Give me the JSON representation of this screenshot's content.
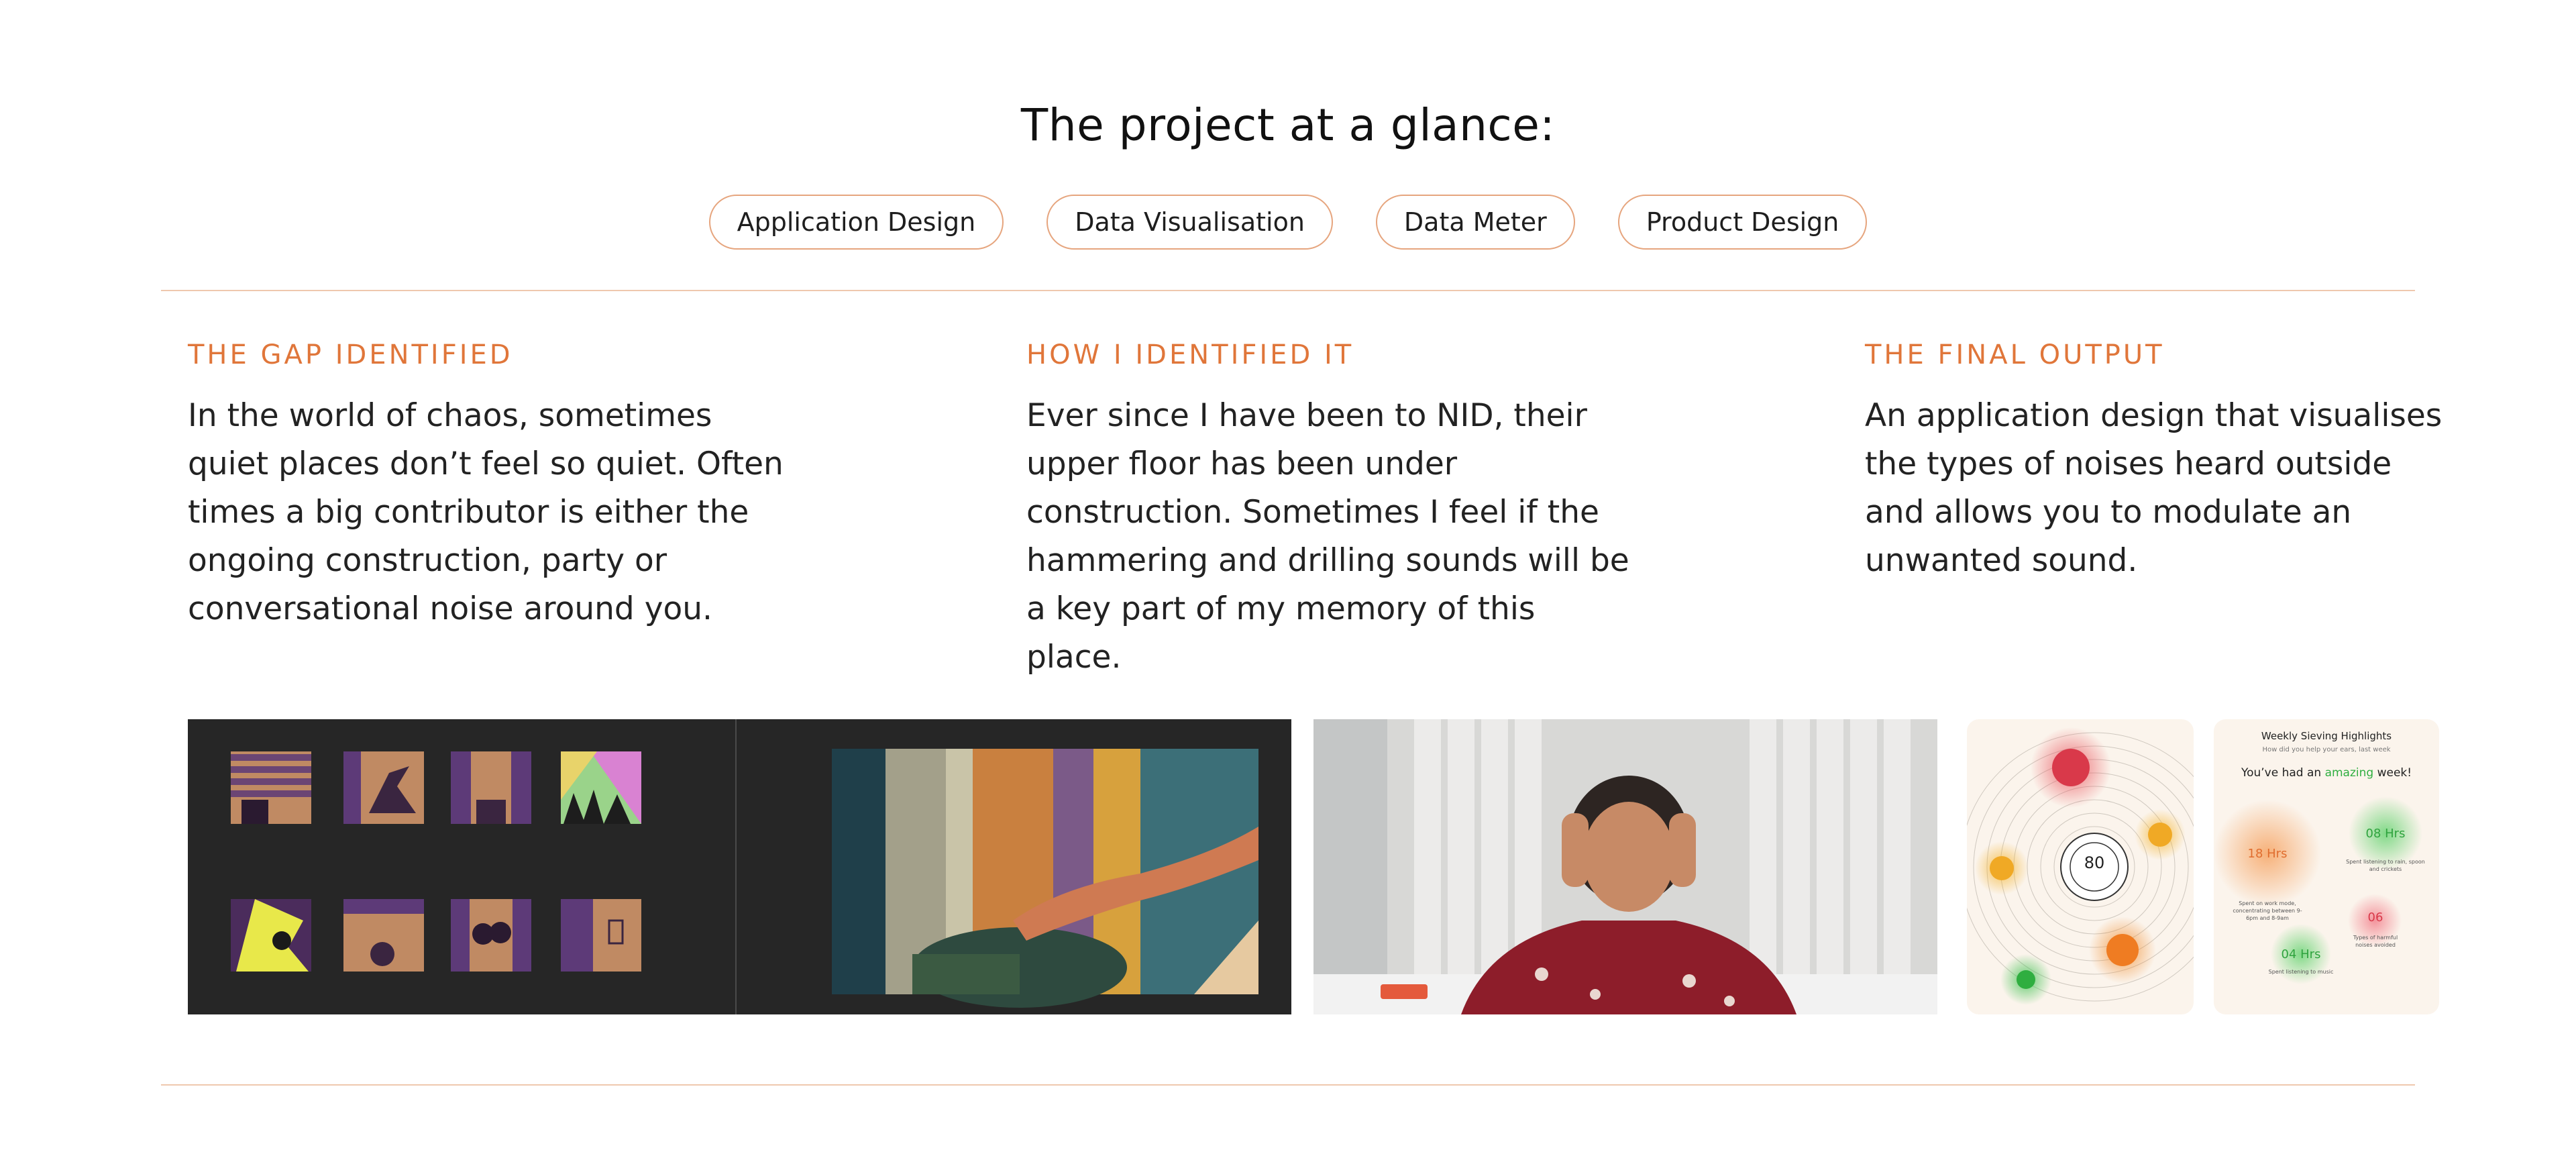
{
  "page": {
    "title": "The project at a glance:"
  },
  "tags": [
    "Application Design",
    "Data Visualisation",
    "Data Meter",
    "Product Design"
  ],
  "columns": [
    {
      "heading": "THE GAP IDENTIFIED",
      "lines": [
        "In the world of chaos, sometimes",
        "quiet places don’t feel so quiet. Often",
        "times a big contributor is either the",
        "ongoing construction, party or",
        "conversational noise around you."
      ]
    },
    {
      "heading": "HOW I IDENTIFIED IT",
      "lines": [
        "Ever since I have been to NID, their",
        "upper floor has been under",
        "construction. Sometimes I feel if the",
        "hammering and drilling sounds will be",
        "a key part of my memory of this place."
      ]
    },
    {
      "heading": "THE FINAL OUTPUT",
      "lines": [
        "An application design that visualises",
        "the types of noises heard outside",
        "and allows you to modulate an",
        "unwanted sound."
      ]
    }
  ],
  "app_screen_radial": {
    "center_value": "80"
  },
  "app_screen_summary": {
    "title": "Weekly Sieving Highlights",
    "subtitle": "How did you help your ears, last week",
    "headline_prefix": "You’ve had an ",
    "headline_accent": "amazing",
    "headline_suffix": " week!",
    "stats": [
      {
        "value": "18 Hrs",
        "label": "Spent on work mode, concentrating between 9-6pm and 8-9am"
      },
      {
        "value": "08 Hrs",
        "label": "Spent listening to rain, spoon and crickets"
      },
      {
        "value": "06",
        "label": "Types of harmful noises avoided"
      },
      {
        "value": "04 Hrs",
        "label": "Spent listening to music"
      }
    ]
  },
  "colors": {
    "accent": "#e0763a",
    "tag_border": "#e6a57e",
    "divider": "#efc8ae"
  }
}
